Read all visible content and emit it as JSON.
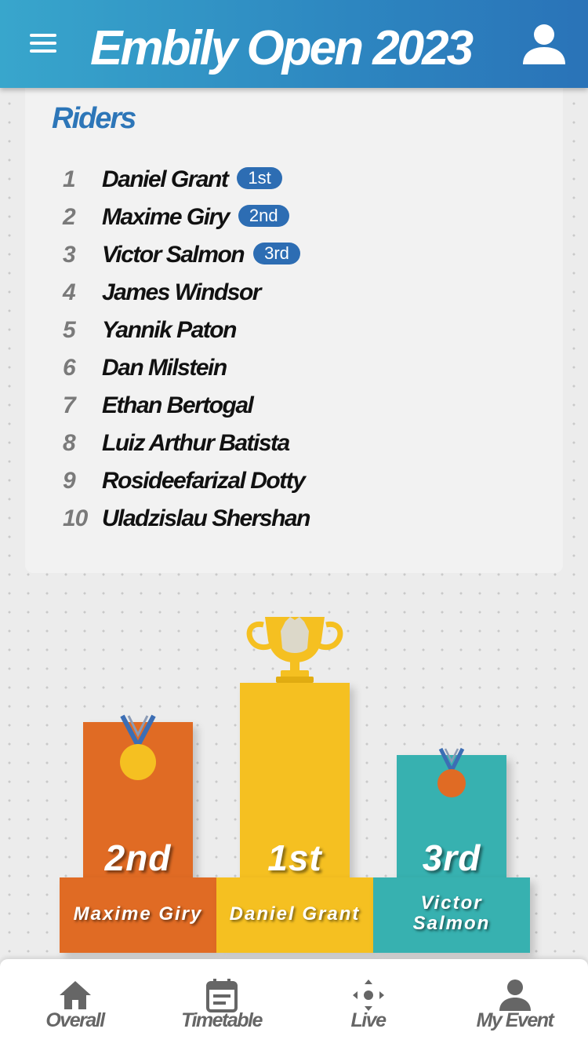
{
  "header": {
    "title": "Embily Open 2023",
    "menu_icon": "hamburger-menu-icon",
    "user_icon": "user-icon"
  },
  "riders": {
    "title": "Riders",
    "list": [
      {
        "rank": "1",
        "name": "Daniel Grant",
        "badge": "1st"
      },
      {
        "rank": "2",
        "name": "Maxime Giry",
        "badge": "2nd"
      },
      {
        "rank": "3",
        "name": "Victor Salmon",
        "badge": "3rd"
      },
      {
        "rank": "4",
        "name": "James Windsor"
      },
      {
        "rank": "5",
        "name": "Yannik Paton"
      },
      {
        "rank": "6",
        "name": "Dan Milstein"
      },
      {
        "rank": "7",
        "name": "Ethan Bertogal"
      },
      {
        "rank": "8",
        "name": "Luiz Arthur Batista"
      },
      {
        "rank": "9",
        "name": "Rosideefarizal Dotty"
      },
      {
        "rank": "10",
        "name": "Uladzislau Shershan"
      }
    ]
  },
  "podium": {
    "first": {
      "place": "1st",
      "name": "Daniel Grant",
      "icon": "trophy-icon"
    },
    "second": {
      "place": "2nd",
      "name": "Maxime Giry",
      "icon": "gold-medal-icon"
    },
    "third": {
      "place": "3rd",
      "name_line1": "Victor",
      "name_line2": "Salmon",
      "icon": "bronze-medal-icon"
    }
  },
  "nav": [
    {
      "label": "Overall",
      "icon": "home-icon"
    },
    {
      "label": "Timetable",
      "icon": "calendar-icon"
    },
    {
      "label": "Live",
      "icon": "live-icon"
    },
    {
      "label": "My Event",
      "icon": "user-icon"
    }
  ],
  "colors": {
    "header_start": "#38a6cc",
    "header_end": "#2a73b8",
    "accent": "#2d76b8",
    "badge": "#2d6db3",
    "podium_first": "#f5c021",
    "podium_second": "#e06b24",
    "podium_third": "#37b1b0",
    "medal_ribbon": "#3c6eb4",
    "medal_gold": "#f5c021",
    "medal_bronze": "#e06b24"
  }
}
